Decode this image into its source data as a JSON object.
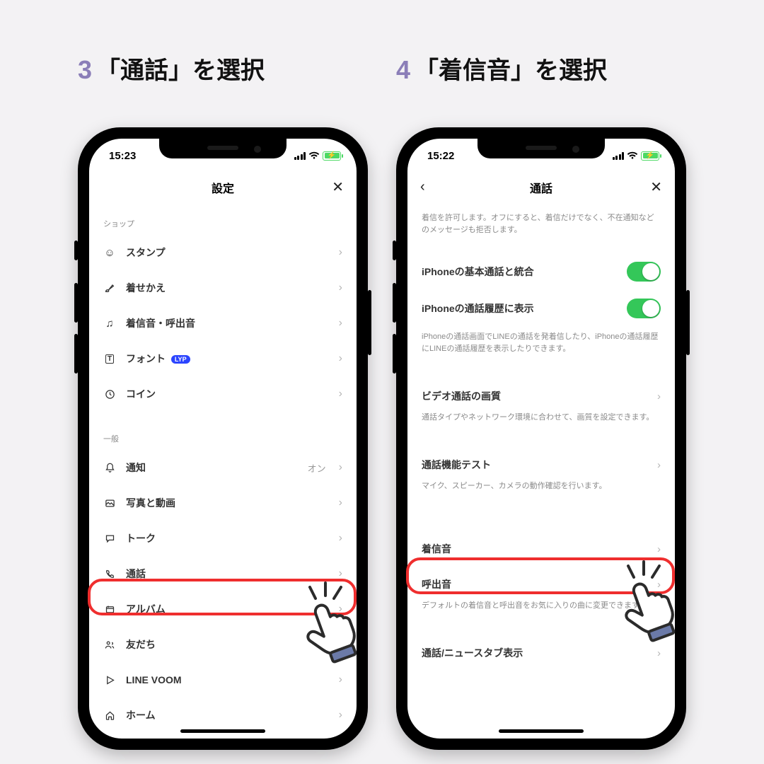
{
  "captions": {
    "left": {
      "num": "3",
      "text": "「通話」を選択"
    },
    "right": {
      "num": "4",
      "text": "「着信音」を選択"
    }
  },
  "left_phone": {
    "status_time": "15:23",
    "header_title": "設定",
    "section_shop": "ショップ",
    "shop_items": [
      {
        "label": "スタンプ"
      },
      {
        "label": "着せかえ"
      },
      {
        "label": "着信音・呼出音"
      },
      {
        "label": "フォント",
        "badge": "LYP"
      },
      {
        "label": "コイン"
      }
    ],
    "section_general": "一般",
    "general_items": [
      {
        "label": "通知",
        "value": "オン"
      },
      {
        "label": "写真と動画"
      },
      {
        "label": "トーク"
      },
      {
        "label": "通話"
      },
      {
        "label": "アルバム"
      },
      {
        "label": "友だち"
      },
      {
        "label": "LINE VOOM"
      },
      {
        "label": "ホーム"
      }
    ]
  },
  "right_phone": {
    "status_time": "15:22",
    "header_title": "通話",
    "top_note": "着信を許可します。オフにすると、着信だけでなく、不在通知などのメッセージも拒否します。",
    "toggle1": "iPhoneの基本通話と統合",
    "toggle2": "iPhoneの通話履歴に表示",
    "toggles_note": "iPhoneの通話画面でLINEの通話を発着信したり、iPhoneの通話履歴にLINEの通話履歴を表示したりできます。",
    "video_q": "ビデオ通話の画質",
    "video_q_note": "通話タイプやネットワーク環境に合わせて、画質を設定できます。",
    "call_test": "通話機能テスト",
    "call_test_note": "マイク、スピーカー、カメラの動作確認を行います。",
    "ringtone": "着信音",
    "callout": "呼出音",
    "ring_note": "デフォルトの着信音と呼出音をお気に入りの曲に変更できます",
    "news_tab": "通話/ニュースタブ表示"
  }
}
